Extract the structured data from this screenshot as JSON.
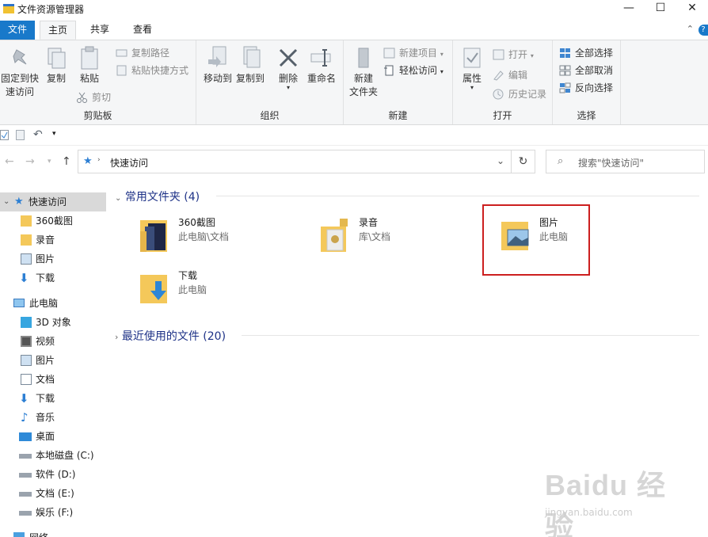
{
  "window": {
    "title": "文件资源管理器",
    "minimize": "—",
    "maximize": "☐",
    "close": "✕"
  },
  "tabs": [
    {
      "label": "文件"
    },
    {
      "label": "主页"
    },
    {
      "label": "共享"
    },
    {
      "label": "查看"
    }
  ],
  "ribbon": {
    "clipboard": {
      "label": "剪贴板",
      "pin_line1": "固定到快",
      "pin_line2": "速访问",
      "copy": "复制",
      "paste": "粘贴",
      "copy_path": "复制路径",
      "paste_shortcut": "粘贴快捷方式",
      "cut": "剪切"
    },
    "organize": {
      "label": "组织",
      "move_to": "移动到",
      "copy_to": "复制到",
      "delete": "删除",
      "rename": "重命名"
    },
    "new": {
      "label": "新建",
      "new_folder_line1": "新建",
      "new_folder_line2": "文件夹",
      "new_item": "新建项目",
      "easy_access": "轻松访问"
    },
    "open": {
      "label": "打开",
      "properties": "属性",
      "open": "打开",
      "edit": "编辑",
      "history": "历史记录"
    },
    "select": {
      "label": "选择",
      "select_all": "全部选择",
      "select_none": "全部取消",
      "invert": "反向选择"
    }
  },
  "addressbar": {
    "path": "快速访问",
    "search_placeholder": "搜索\"快速访问\""
  },
  "navpane": {
    "quick_access": "快速访问",
    "qa_items": [
      "360截图",
      "录音",
      "图片",
      "下载"
    ],
    "this_pc": "此电脑",
    "pc_items": [
      "3D 对象",
      "视频",
      "图片",
      "文档",
      "下载",
      "音乐",
      "桌面",
      "本地磁盘 (C:)",
      "软件 (D:)",
      "文档 (E:)",
      "娱乐 (F:)"
    ],
    "network": "网络"
  },
  "content": {
    "frequent_header": "常用文件夹 (4)",
    "recent_header": "最近使用的文件 (20)",
    "folders": [
      {
        "name": "360截图",
        "location": "此电脑\\文档"
      },
      {
        "name": "录音",
        "location": "库\\文档"
      },
      {
        "name": "图片",
        "location": "此电脑"
      },
      {
        "name": "下载",
        "location": "此电脑"
      }
    ]
  },
  "watermark": {
    "logo": "Baidu 经验",
    "url": "jingyan.baidu.com"
  },
  "colors": {
    "accent": "#1979ca",
    "highlight_box": "#cc1f1f",
    "folder_yellow": "#f4c85a"
  }
}
